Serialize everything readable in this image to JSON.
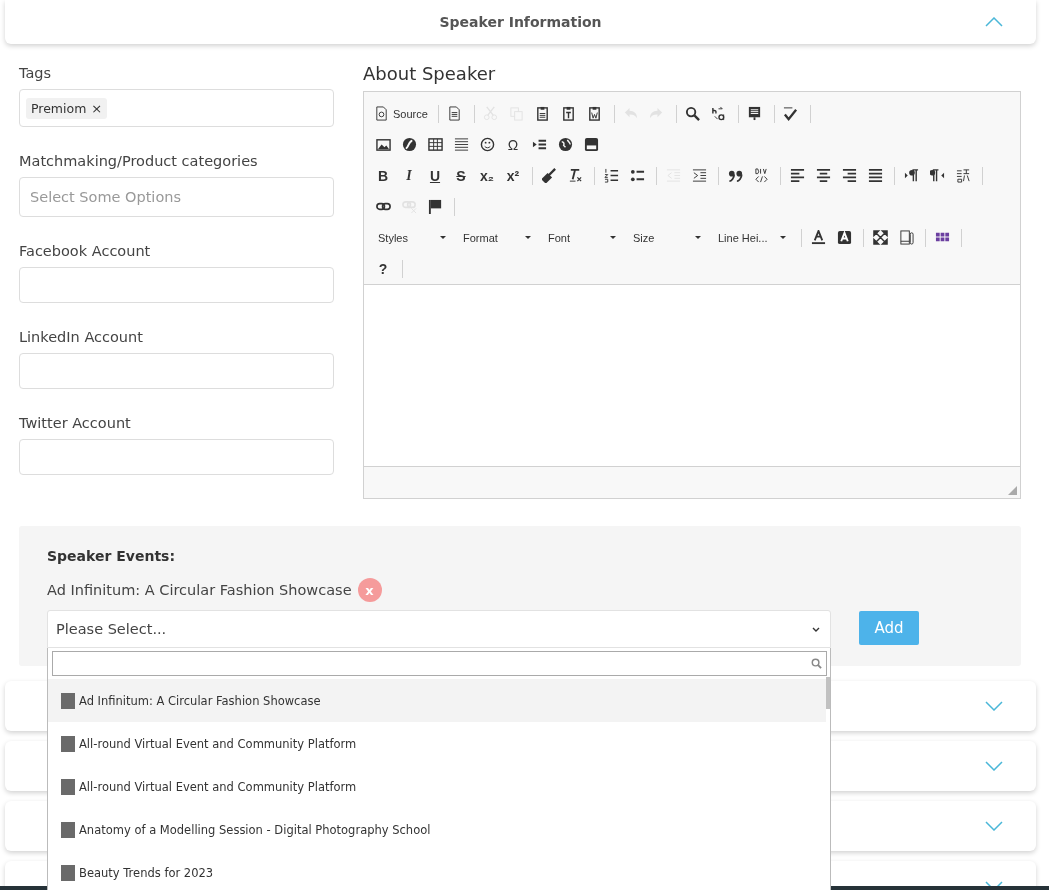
{
  "header_panel": {
    "title": "Speaker Information",
    "expanded": true
  },
  "fields": [
    {
      "kind": "tags",
      "label": "Tags",
      "tags": [
        "Premiom"
      ],
      "remove_glyph": "×"
    },
    {
      "kind": "multiselect",
      "label": "Matchmaking/Product categories",
      "placeholder": "Select Some Options"
    },
    {
      "kind": "text",
      "label": "Facebook Account"
    },
    {
      "kind": "text",
      "label": "LinkedIn Account"
    },
    {
      "kind": "text",
      "label": "Twitter Account"
    }
  ],
  "editor": {
    "label": "About Speaker",
    "toolbar_rows": [
      [
        [
          {
            "kind": "icon",
            "label": "Source",
            "disabled": false
          }
        ],
        [
          {
            "kind": "icon",
            "disabled": false
          }
        ],
        [
          {
            "kind": "icon",
            "disabled": true
          },
          {
            "kind": "icon",
            "disabled": true
          },
          {
            "kind": "icon",
            "disabled": false
          },
          {
            "kind": "icon",
            "disabled": false
          },
          {
            "kind": "icon",
            "disabled": false
          }
        ],
        [
          {
            "kind": "icon",
            "disabled": true
          },
          {
            "kind": "icon",
            "disabled": true
          }
        ],
        [
          {
            "kind": "icon",
            "disabled": false
          },
          {
            "kind": "icon",
            "disabled": false
          }
        ],
        [
          {
            "kind": "icon",
            "disabled": false
          }
        ],
        [
          {
            "kind": "icon",
            "disabled": false
          }
        ]
      ],
      [
        [
          {
            "kind": "icon",
            "disabled": false
          },
          {
            "kind": "icon",
            "disabled": false
          },
          {
            "kind": "icon",
            "disabled": false
          },
          {
            "kind": "icon",
            "disabled": false
          },
          {
            "kind": "icon",
            "disabled": false
          },
          {
            "kind": "glyph",
            "text": "Ω",
            "disabled": false
          },
          {
            "kind": "icon",
            "disabled": false
          },
          {
            "kind": "icon",
            "disabled": false
          },
          {
            "kind": "icon",
            "disabled": false
          }
        ]
      ],
      [
        [
          {
            "kind": "glyph",
            "text": "B",
            "disabled": false
          },
          {
            "kind": "glyph",
            "text": "I",
            "disabled": false
          },
          {
            "kind": "glyph",
            "text": "U",
            "disabled": false
          },
          {
            "kind": "glyph",
            "text": "S",
            "disabled": false
          },
          {
            "kind": "glyph",
            "text": "x₂",
            "disabled": false
          },
          {
            "kind": "glyph",
            "text": "x²",
            "disabled": false
          }
        ],
        [
          {
            "kind": "icon",
            "disabled": false
          },
          {
            "kind": "icon",
            "disabled": false
          }
        ],
        [
          {
            "kind": "icon",
            "disabled": false
          },
          {
            "kind": "icon",
            "disabled": false
          }
        ],
        [
          {
            "kind": "icon",
            "disabled": true
          },
          {
            "kind": "icon",
            "disabled": false
          }
        ],
        [
          {
            "kind": "icon",
            "disabled": false
          },
          {
            "kind": "icon",
            "disabled": false
          }
        ],
        [
          {
            "kind": "icon",
            "disabled": false
          },
          {
            "kind": "icon",
            "disabled": false
          },
          {
            "kind": "icon",
            "disabled": false
          },
          {
            "kind": "icon",
            "disabled": false
          }
        ],
        [
          {
            "kind": "icon",
            "disabled": false
          },
          {
            "kind": "icon",
            "disabled": false
          },
          {
            "kind": "icon",
            "disabled": false
          }
        ]
      ],
      [
        [
          {
            "kind": "icon",
            "disabled": false
          },
          {
            "kind": "icon",
            "disabled": true
          },
          {
            "kind": "icon",
            "disabled": false
          }
        ]
      ],
      [
        [
          {
            "kind": "combo",
            "label": "Styles",
            "disabled": false
          },
          {
            "kind": "combo",
            "label": "Format",
            "disabled": false
          },
          {
            "kind": "combo",
            "label": "Font",
            "disabled": false
          },
          {
            "kind": "combo",
            "label": "Size",
            "disabled": false
          },
          {
            "kind": "combo",
            "label": "Line Hei...",
            "disabled": false
          }
        ],
        [
          {
            "kind": "icon",
            "disabled": false
          },
          {
            "kind": "icon",
            "disabled": false
          }
        ],
        [
          {
            "kind": "icon",
            "disabled": false
          },
          {
            "kind": "icon",
            "disabled": false
          }
        ],
        [
          {
            "kind": "icon",
            "disabled": false
          }
        ]
      ],
      [
        [
          {
            "kind": "glyph",
            "text": "?",
            "disabled": false
          }
        ]
      ]
    ]
  },
  "speaker_events": {
    "title": "Speaker Events:",
    "chosen": [
      {
        "name": "Ad Infinitum: A Circular Fashion Showcase",
        "remove_glyph": "x"
      }
    ],
    "select": {
      "placeholder": "Please Select...",
      "open": true
    },
    "add_button": "Add",
    "options": [
      {
        "label": "Ad Infinitum: A Circular Fashion Showcase",
        "selected": true
      },
      {
        "label": "All-round Virtual Event and Community Platform",
        "selected": false
      },
      {
        "label": "All-round Virtual Event and Community Platform",
        "selected": false
      },
      {
        "label": "Anatomy of a Modelling Session - Digital Photography School",
        "selected": false
      },
      {
        "label": "Beauty Trends for 2023",
        "selected": false
      }
    ]
  },
  "collapsed_panels": [
    {
      "expanded": false
    },
    {
      "expanded": false
    },
    {
      "expanded": false
    },
    {
      "expanded": false
    }
  ]
}
